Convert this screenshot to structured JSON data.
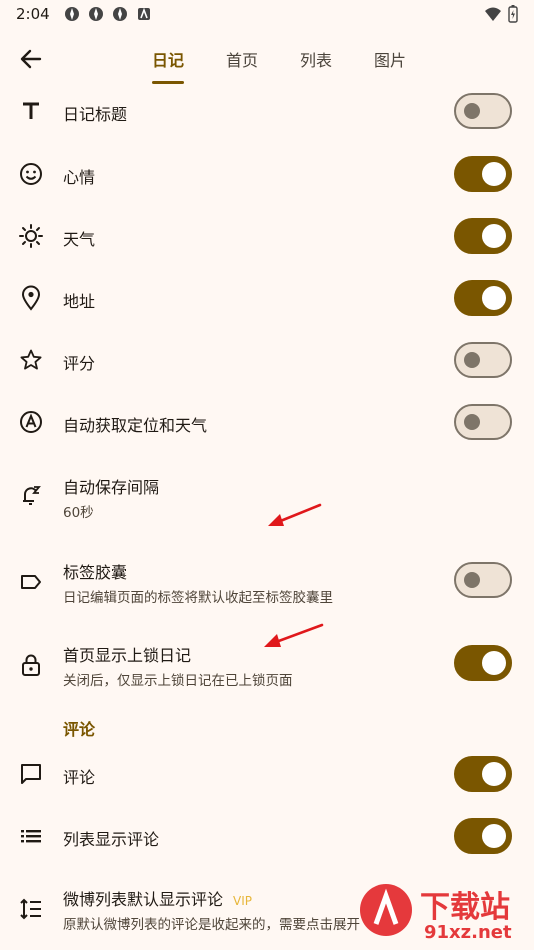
{
  "status_bar": {
    "time": "2:04"
  },
  "tabs": [
    {
      "label": "日记",
      "active": true
    },
    {
      "label": "首页",
      "active": false
    },
    {
      "label": "列表",
      "active": false
    },
    {
      "label": "图片",
      "active": false
    }
  ],
  "settings": {
    "diary_title": {
      "title": "日记标题",
      "toggle": false
    },
    "mood": {
      "title": "心情",
      "toggle": true
    },
    "weather": {
      "title": "天气",
      "toggle": true
    },
    "address": {
      "title": "地址",
      "toggle": true
    },
    "rating": {
      "title": "评分",
      "toggle": false
    },
    "auto_location": {
      "title": "自动获取定位和天气",
      "toggle": false
    },
    "autosave": {
      "title": "自动保存间隔",
      "subtitle": "60秒"
    },
    "tag_capsule": {
      "title": "标签胶囊",
      "subtitle": "日记编辑页面的标签将默认收起至标签胶囊里",
      "toggle": false
    },
    "home_locked": {
      "title": "首页显示上锁日记",
      "subtitle": "关闭后，仅显示上锁日记在已上锁页面",
      "toggle": true
    }
  },
  "comments_section": {
    "label": "评论",
    "comments": {
      "title": "评论",
      "toggle": true
    },
    "list_comments": {
      "title": "列表显示评论",
      "toggle": true
    },
    "weibo": {
      "title": "微博列表默认显示评论",
      "badge": "VIP",
      "subtitle": "原默认微博列表的评论是收起来的，需要点击展开"
    }
  },
  "watermark": {
    "text_top": "下载站",
    "text_bottom": "91xz.net"
  },
  "colors": {
    "accent": "#7A5600",
    "background": "#FFF8F3",
    "annotation_arrow": "#E0181B"
  }
}
